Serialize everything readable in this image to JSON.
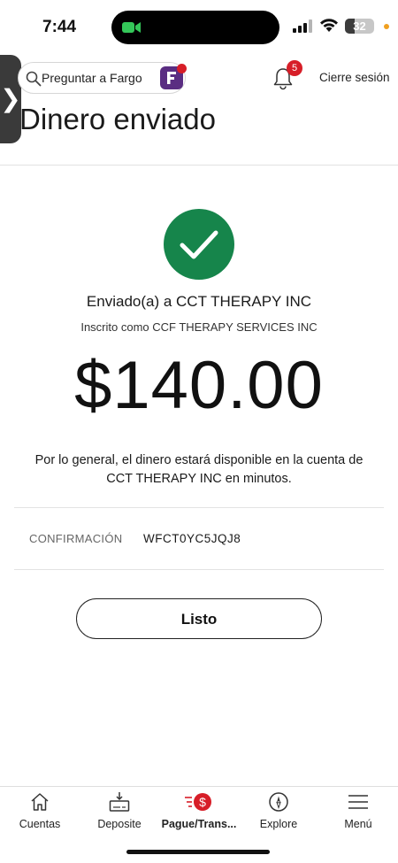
{
  "status_bar": {
    "time": "7:44",
    "battery": "32",
    "battery_level": 0.32,
    "camera_color": "#34c759",
    "privacy_dot_color": "#f0a020"
  },
  "header": {
    "side_tab_glyph": "❯",
    "search_placeholder": "Preguntar a Fargo",
    "notification_count": "5",
    "logout_label": "Cierre sesión",
    "title": "Dinero enviado"
  },
  "confirmation": {
    "sent_to": "Enviado(a) a CCT THERAPY INC",
    "registered_as": "Inscrito como CCF THERAPY SERVICES INC",
    "amount": "$140.00",
    "availability_line1": "Por lo general, el dinero estará disponible en la cuenta de",
    "availability_line2": "CCT THERAPY INC en minutos.",
    "confirmation_label": "CONFIRMACIÓN",
    "confirmation_number": "WFCT0YC5JQJ8",
    "done_label": "Listo"
  },
  "colors": {
    "brand_red": "#d71e28",
    "success_green": "#16854b",
    "fargo_purple": "#5a2d82"
  },
  "tab_bar": {
    "items": [
      {
        "label": "Cuentas",
        "icon": "home-icon",
        "active": false
      },
      {
        "label": "Deposite",
        "icon": "deposit-icon",
        "active": false
      },
      {
        "label": "Pague/Trans...",
        "icon": "pay-transfer-icon",
        "active": true
      },
      {
        "label": "Explore",
        "icon": "compass-icon",
        "active": false
      },
      {
        "label": "Menú",
        "icon": "menu-icon",
        "active": false
      }
    ]
  }
}
